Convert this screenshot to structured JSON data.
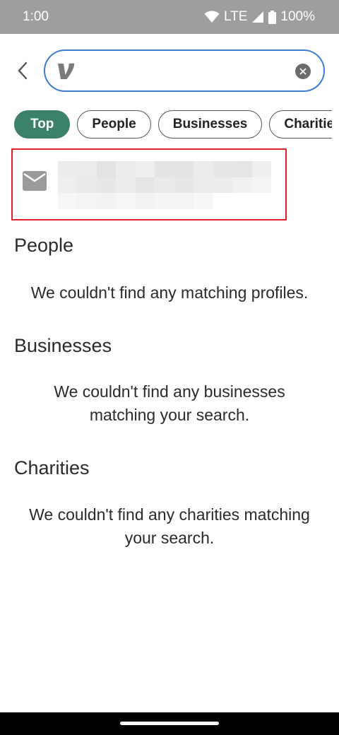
{
  "status_bar": {
    "time": "1:00",
    "network": "LTE",
    "battery": "100%"
  },
  "search": {
    "value": "",
    "logo_icon": "venmo-logo-icon",
    "clear_icon": "clear-icon"
  },
  "chips": [
    {
      "label": "Top",
      "active": true
    },
    {
      "label": "People",
      "active": false
    },
    {
      "label": "Businesses",
      "active": false
    },
    {
      "label": "Charities",
      "active": false
    }
  ],
  "email_result": {
    "icon": "mail-icon"
  },
  "sections": {
    "people": {
      "title": "People",
      "message": "We couldn't find any matching profiles."
    },
    "businesses": {
      "title": "Businesses",
      "message_line1": "We couldn't find any businesses",
      "message_line2": "matching your search."
    },
    "charities": {
      "title": "Charities",
      "message_line1": "We couldn't find any charities matching",
      "message_line2": "your search."
    }
  },
  "colors": {
    "accent_green": "#3b8068",
    "search_border": "#3d7bd6",
    "highlight_red": "#e0202a"
  }
}
